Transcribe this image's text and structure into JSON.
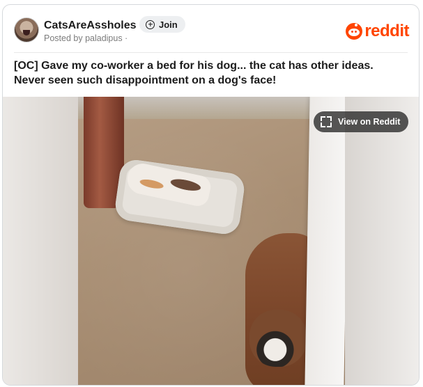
{
  "header": {
    "subreddit": "CatsAreAssholes",
    "posted_by": "Posted by paladipus ·",
    "join_label": "Join",
    "logo_text": "reddit"
  },
  "post": {
    "title": "[OC] Gave my co-worker a bed for his dog... the cat has other ideas. Never seen such disappointment on a dog's face!"
  },
  "media": {
    "view_label": "View on Reddit"
  },
  "colors": {
    "brand": "#ff4500",
    "join_bg": "#edeff1"
  },
  "icons": [
    "subreddit-avatar",
    "plus-circle-icon",
    "reddit-logo-icon",
    "expand-icon"
  ]
}
